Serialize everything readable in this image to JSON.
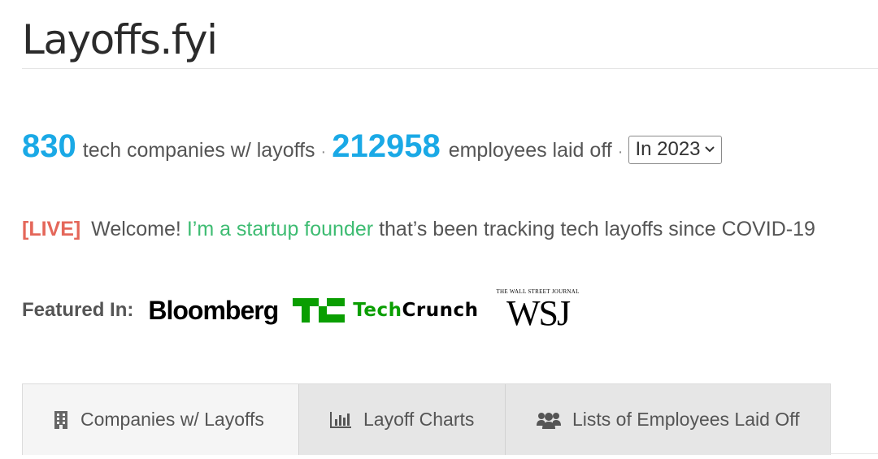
{
  "site": {
    "title": "Layoffs.fyi"
  },
  "stats": {
    "companies_count": "830",
    "companies_label": "tech companies w/ layoffs",
    "separator": "·",
    "employees_count": "212958",
    "employees_label": "employees laid off",
    "year_select_value": "In 2023"
  },
  "welcome": {
    "live_tag": "[LIVE]",
    "greeting": "Welcome!",
    "founder_link": "I’m a startup founder",
    "rest": "that’s been tracking tech layoffs since COVID-19"
  },
  "featured": {
    "label": "Featured In:",
    "logos": {
      "bloomberg": "Bloomberg",
      "techcrunch_tech": "Tech",
      "techcrunch_crunch": "Crunch",
      "wsj_small": "THE WALL STREET JOURNAL",
      "wsj_big": "WSJ"
    }
  },
  "tabs": [
    {
      "label": "Companies w/ Layoffs",
      "icon": "building-icon"
    },
    {
      "label": "Layoff Charts",
      "icon": "bar-chart-icon"
    },
    {
      "label": "Lists of Employees Laid Off",
      "icon": "users-icon"
    }
  ],
  "colors": {
    "accent_blue": "#1aa9e6",
    "live_red": "#e4675a",
    "link_green": "#3ebc72",
    "techcrunch_green": "#0a9e01"
  }
}
